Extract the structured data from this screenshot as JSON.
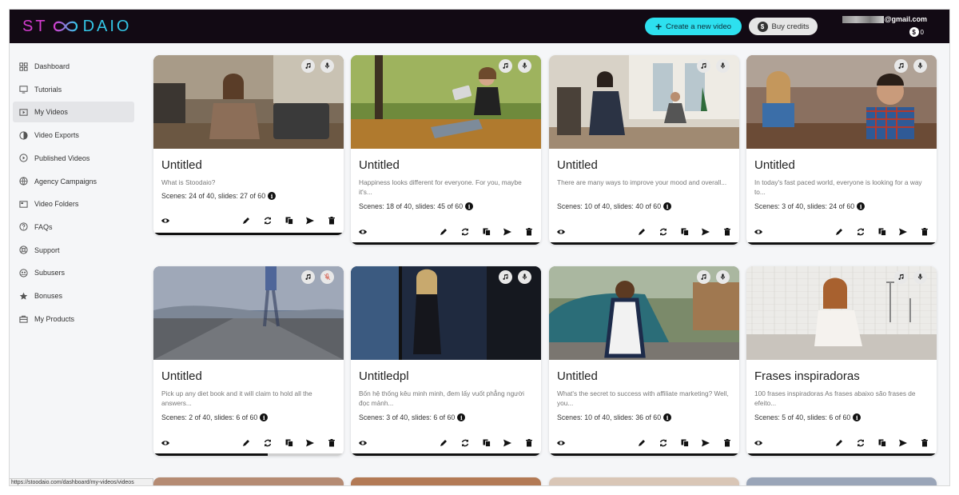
{
  "app": {
    "logo_left": "ST",
    "logo_right": "DAIO"
  },
  "header": {
    "create_label": "Create a new video",
    "credits_label": "Buy credits",
    "email_suffix": "@gmail.com",
    "credits_count": "0"
  },
  "sidebar": {
    "items": [
      {
        "label": "Dashboard",
        "icon": "dashboard-icon"
      },
      {
        "label": "Tutorials",
        "icon": "tutorials-icon"
      },
      {
        "label": "My Videos",
        "icon": "video-icon",
        "active": true
      },
      {
        "label": "Video Exports",
        "icon": "export-icon"
      },
      {
        "label": "Published Videos",
        "icon": "published-icon"
      },
      {
        "label": "Agency Campaigns",
        "icon": "campaign-icon"
      },
      {
        "label": "Video Folders",
        "icon": "folder-icon"
      },
      {
        "label": "FAQs",
        "icon": "help-icon"
      },
      {
        "label": "Support",
        "icon": "support-icon"
      },
      {
        "label": "Subusers",
        "icon": "users-icon"
      },
      {
        "label": "Bonuses",
        "icon": "star-icon"
      },
      {
        "label": "My Products",
        "icon": "products-icon"
      }
    ]
  },
  "cards": [
    {
      "title": "Untitled",
      "desc": "What is Stoodaio?",
      "scenes": "Scenes: 24 of 40, slides: 27 of 60",
      "progress": 1.0,
      "mic_muted": false
    },
    {
      "title": "Untitled",
      "desc": "Happiness looks different for everyone. For you, maybe it's...",
      "scenes": "Scenes: 18 of 40, slides: 45 of 60",
      "progress": 1.0,
      "mic_muted": false
    },
    {
      "title": "Untitled",
      "desc": "There are many ways to improve your mood and overall...",
      "scenes": "Scenes: 10 of 40, slides: 40 of 60",
      "progress": 1.0,
      "mic_muted": false
    },
    {
      "title": "Untitled",
      "desc": "In today's fast paced world, everyone is looking for a way to...",
      "scenes": "Scenes: 3 of 40, slides: 24 of 60",
      "progress": 1.0,
      "mic_muted": false
    },
    {
      "title": "Untitled",
      "desc": "Pick up any diet book and it will claim to hold all the answers...",
      "scenes": "Scenes: 2 of 40, slides: 6 of 60",
      "progress": 0.6,
      "mic_muted": true
    },
    {
      "title": "Untitledpl",
      "desc": "Bốn hệ thống kêu minh minh, đem lấy vuốt phẳng người đọc mảnh...",
      "scenes": "Scenes: 3 of 40, slides: 6 of 60",
      "progress": 1.0,
      "mic_muted": false
    },
    {
      "title": "Untitled",
      "desc": "What's the secret to success with affiliate marketing? Well, you...",
      "scenes": "Scenes: 10 of 40, slides: 36 of 60",
      "progress": 1.0,
      "mic_muted": false
    },
    {
      "title": "Frases inspiradoras",
      "desc": "100 frases inspiradoras As frases abaixo são frases de efeito...",
      "scenes": "Scenes: 5 of 40, slides: 6 of 60",
      "progress": 1.0,
      "mic_muted": false
    }
  ],
  "statusbar": {
    "url": "https://stoodaio.com/dashboard/my-videos/videos"
  },
  "colors": {
    "topbar": "#120a14",
    "accent": "#2de0ef",
    "logo_pink": "#d43ccf",
    "logo_cyan": "#33c6e6"
  }
}
